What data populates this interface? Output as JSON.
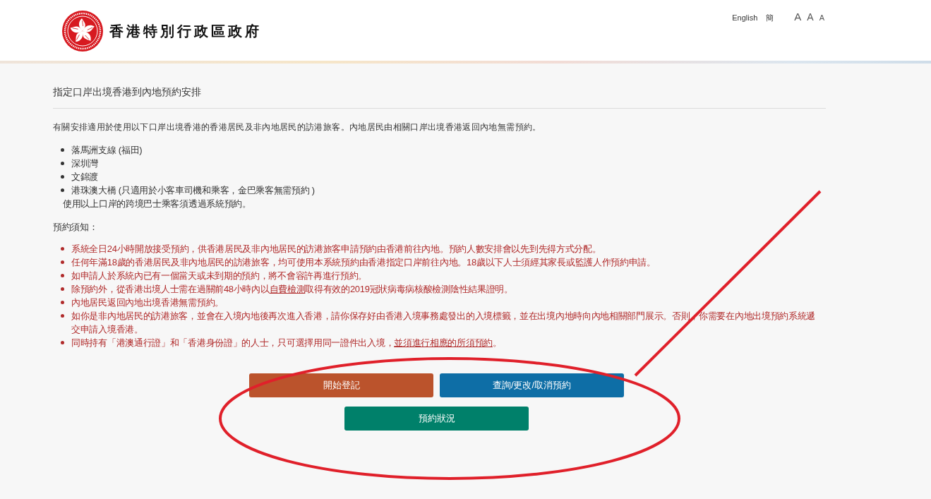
{
  "header": {
    "title": "香港特別行政區政府",
    "language_links": [
      "English",
      "簡"
    ],
    "font_size_options": [
      {
        "label": "A",
        "kind": "large"
      },
      {
        "label": "A",
        "kind": "medium"
      },
      {
        "label": "A",
        "kind": "small"
      }
    ]
  },
  "page_title": "指定口岸出境香港到內地預約安排",
  "intro": "有關安排適用於使用以下口岸出境香港的香港居民及非內地居民的訪港旅客。內地居民由相關口岸出境香港返回內地無需預約。",
  "checkpoints": [
    "落馬洲支線 (福田)",
    "深圳灣",
    "文錦渡",
    "港珠澳大橋 (只適用於小客車司機和乘客，金巴乘客無需預約 )"
  ],
  "checkpoint_note": "使用以上口岸的跨境巴士乘客須透過系統預約。",
  "notice_heading": "預約須知：",
  "notices": [
    [
      {
        "kind": "text",
        "text": "系統全日24小時開放接受預約，供香港居民及非內地居民的訪港旅客申請預約由香港前往內地。預約人數安排會以先到先得方式分配。"
      }
    ],
    [
      {
        "kind": "text",
        "text": "任何年滿18歲的香港居民及非內地居民的訪港旅客，均可使用本系統預約由香港指定口岸前往內地。18歲以下人士須經其家長或監護人作預約申請。"
      }
    ],
    [
      {
        "kind": "text",
        "text": "如申請人於系統內已有一個當天或未到期的預約，將不會容許再進行預約。"
      }
    ],
    [
      {
        "kind": "text",
        "text": "除預約外，從香港出境人士需在過關前48小時內以"
      },
      {
        "kind": "link",
        "text": "自費檢測"
      },
      {
        "kind": "text",
        "text": "取得有效的2019冠狀病毒病核酸檢測陰性結果證明。"
      }
    ],
    [
      {
        "kind": "text",
        "text": "內地居民返回內地出境香港無需預約。"
      }
    ],
    [
      {
        "kind": "text",
        "text": "如你是非內地居民的訪港旅客，並會在入境內地後再次進入香港，請你保存好由香港入境事務處發出的入境標籤，並在出境內地時向內地相關部門展示。否則，你需要在內地出境預約系統遞交申請入境香港。"
      }
    ],
    [
      {
        "kind": "text",
        "text": "同時持有「港澳通行證」和「香港身份證」的人士，只可選擇用同一證件出入境，"
      },
      {
        "kind": "link",
        "text": "並須進行相應的所須預約"
      },
      {
        "kind": "text",
        "text": "。"
      }
    ]
  ],
  "buttons": [
    {
      "label": "開始登記",
      "color": "#bb532c"
    },
    {
      "label": "查詢/更改/取消預約",
      "color": "#0e6ea6"
    },
    {
      "label": "預約狀況",
      "color": "#00806a"
    }
  ]
}
